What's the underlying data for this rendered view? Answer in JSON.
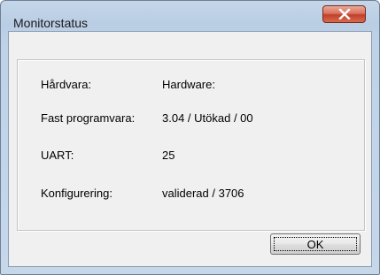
{
  "window": {
    "title": "Monitorstatus"
  },
  "titlebar": {
    "close_icon": "close-x-icon",
    "close_color": "#c7432b"
  },
  "info": {
    "rows": [
      {
        "label": "Hårdvara:",
        "value": "Hardware:"
      },
      {
        "label": "Fast programvara:",
        "value": "3.04 / Utökad / 00"
      },
      {
        "label": "UART:",
        "value": "25"
      },
      {
        "label": "Konfigurering:",
        "value": "validerad / 3706"
      }
    ]
  },
  "buttons": {
    "ok_label": "OK"
  }
}
